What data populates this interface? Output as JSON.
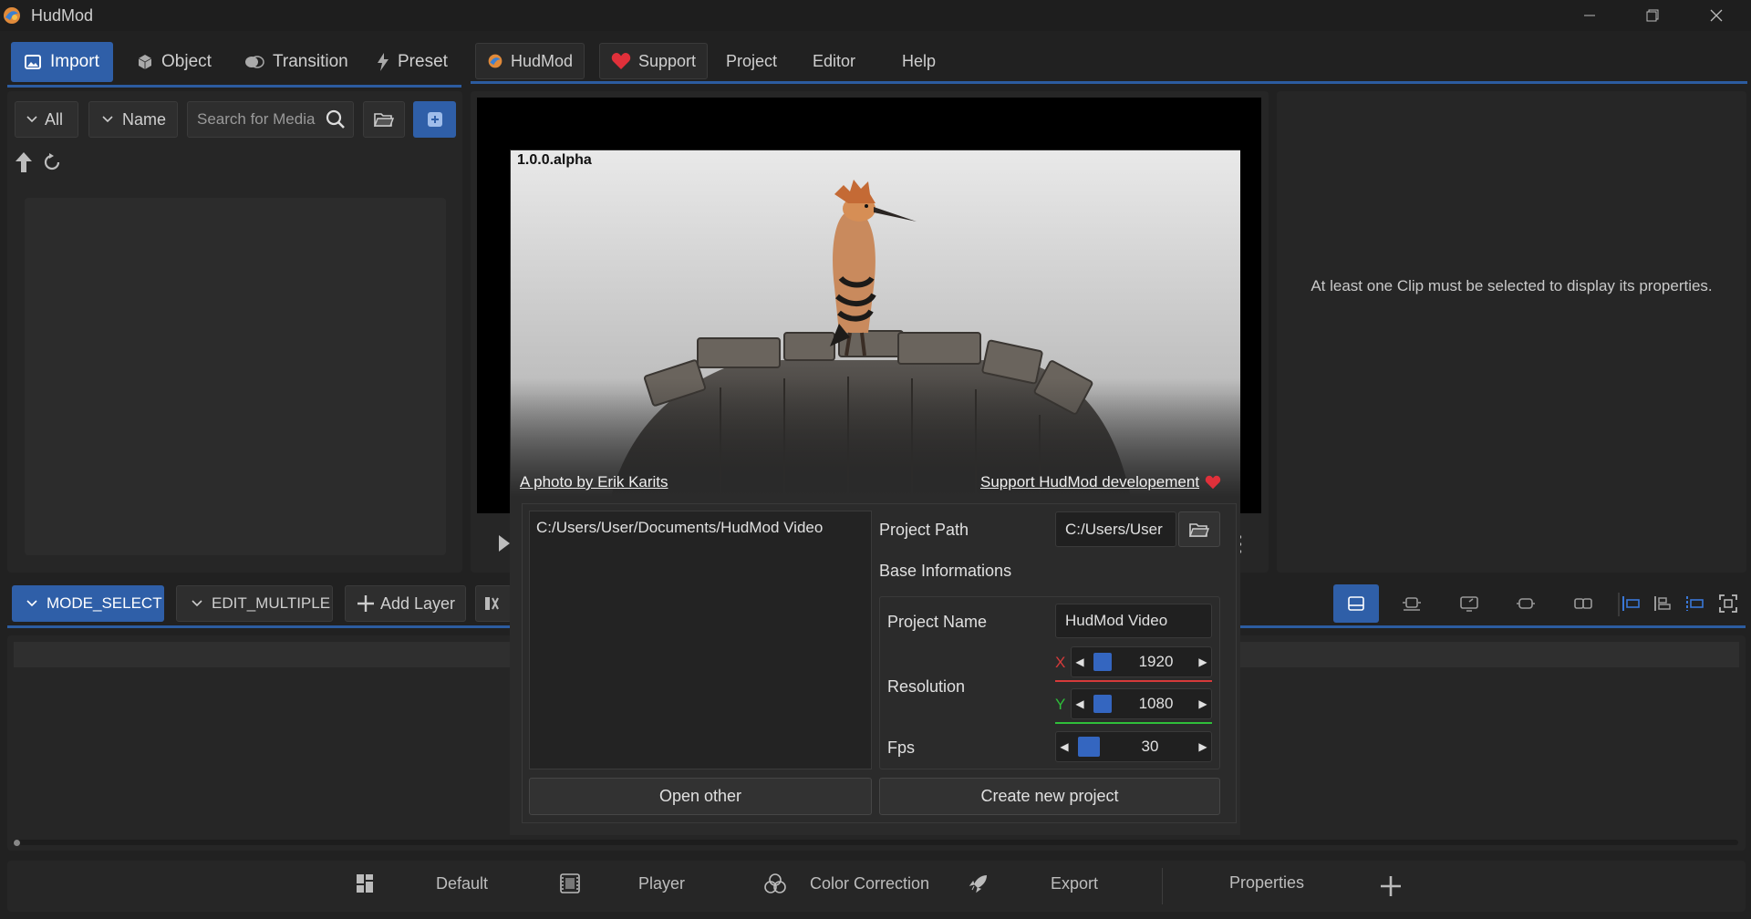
{
  "window": {
    "title": "HudMod"
  },
  "left_tabs": [
    {
      "label": "Import",
      "icon": "image-icon"
    },
    {
      "label": "Object",
      "icon": "cube-icon"
    },
    {
      "label": "Transition",
      "icon": "transition-icon"
    },
    {
      "label": "Preset",
      "icon": "lightning-icon"
    }
  ],
  "top_menu": {
    "hudmod": "HudMod",
    "support": "Support",
    "project": "Project",
    "editor": "Editor",
    "help": "Help"
  },
  "media": {
    "filter_all": "All",
    "sort_name": "Name",
    "search_placeholder": "Search for Media"
  },
  "properties": {
    "empty_message": "At least one Clip must be selected to display its properties."
  },
  "timeline": {
    "mode_select": "MODE_SELECT",
    "edit_multiple": "EDIT_MULTIPLE",
    "add_layer": "Add Layer"
  },
  "dialog": {
    "version": "1.0.0.alpha",
    "photo_credit": "A photo by Erik Karits",
    "support_link": "Support HudMod developement",
    "recent_projects": [
      "C:/Users/User/Documents/HudMod Video"
    ],
    "project_path_label": "Project Path",
    "project_path_value": "C:/Users/User",
    "base_info_label": "Base Informations",
    "project_name_label": "Project Name",
    "project_name_value": "HudMod Video",
    "resolution_label": "Resolution",
    "res_x_label": "X",
    "res_x": "1920",
    "res_y_label": "Y",
    "res_y": "1080",
    "fps_label": "Fps",
    "fps": "30",
    "open_other": "Open other",
    "create_new": "Create new project"
  },
  "workspace_bar": {
    "default": "Default",
    "player": "Player",
    "color_correction": "Color Correction",
    "export": "Export",
    "properties": "Properties"
  },
  "colors": {
    "accent": "#2f5fa8",
    "bg": "#212121",
    "panel": "#262626",
    "axis_x": "#d63a3a",
    "axis_y": "#2fbf3a",
    "heart": "#e0303a"
  }
}
